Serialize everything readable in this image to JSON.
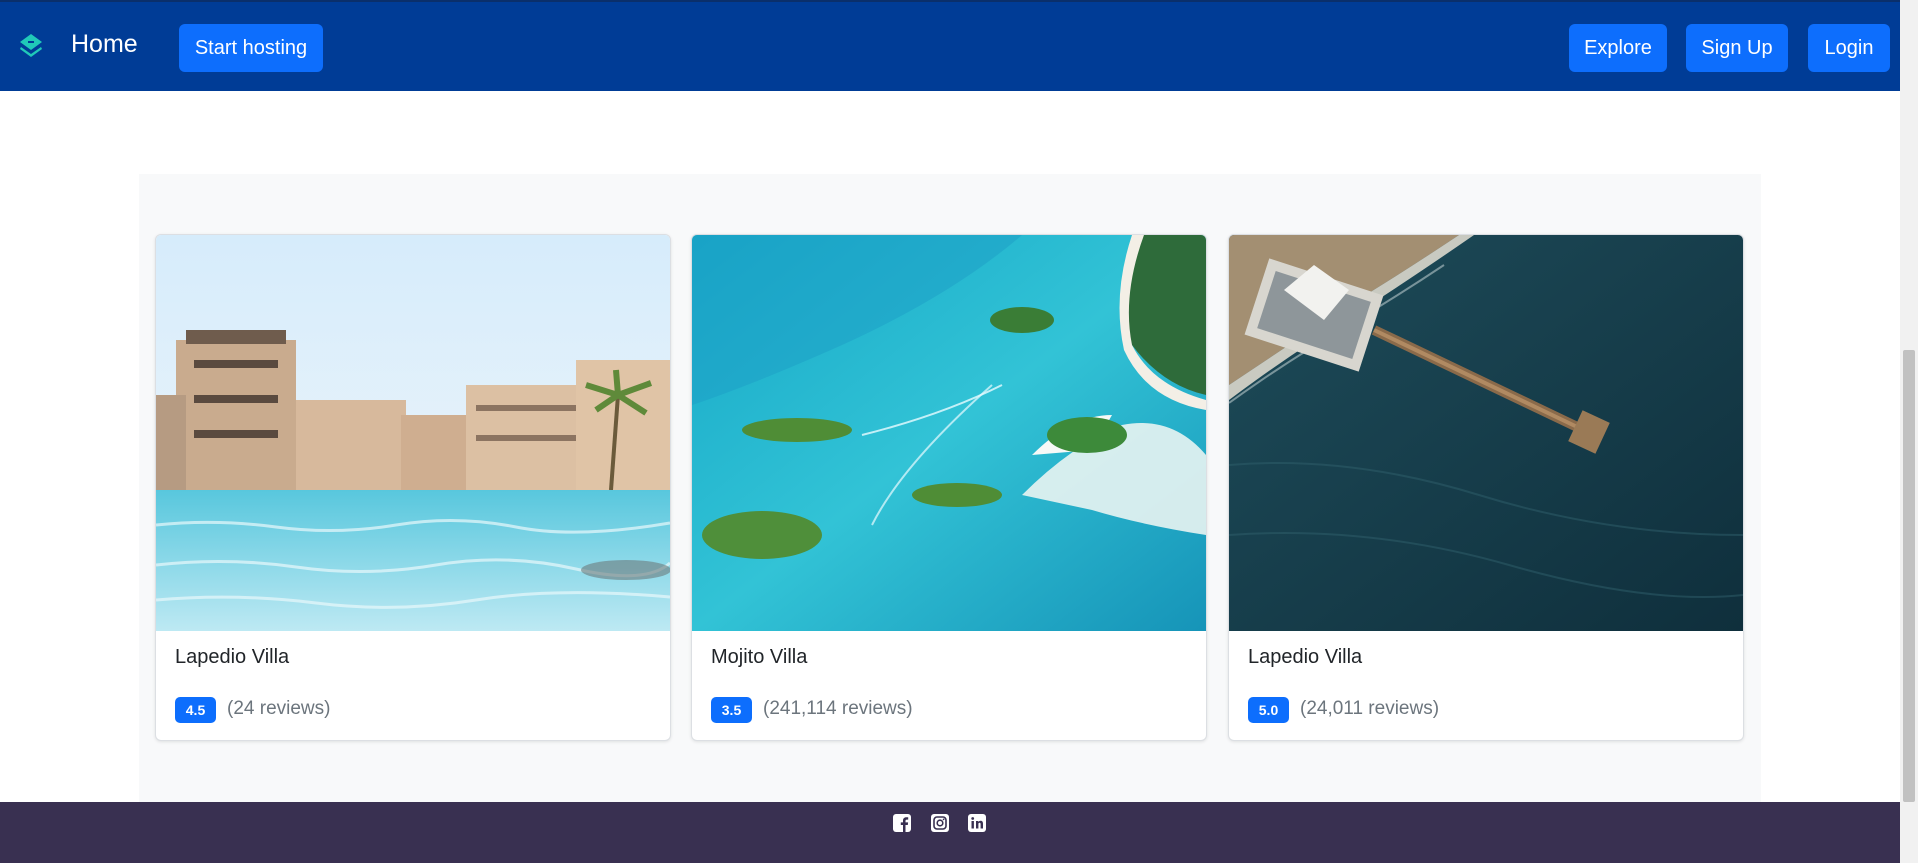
{
  "navbar": {
    "logo_icon": "layers-diamond-icon",
    "title": "Home",
    "host_button": "Start hosting",
    "links": [
      "Explore",
      "Sign Up",
      "Login"
    ]
  },
  "colors": {
    "navbar_bg": "#003c96",
    "button_primary": "#0d6efd",
    "logo_accent": "#20c9b8",
    "section_bg": "#f8f9fa",
    "footer_bg": "#393051"
  },
  "listings": [
    {
      "image": "luxury-resort-pool-photo",
      "name": "Lapedio Villa",
      "rating": "4.5",
      "reviews": "(24 reviews)"
    },
    {
      "image": "tropical-lagoon-aerial-photo",
      "name": "Mojito Villa",
      "rating": "3.5",
      "reviews": "(241,114 reviews)"
    },
    {
      "image": "ocean-pier-aerial-photo",
      "name": "Lapedio Villa",
      "rating": "5.0",
      "reviews": "(24,011 reviews)"
    }
  ],
  "footer": {
    "social_icons": [
      "facebook-icon",
      "instagram-icon",
      "linkedin-icon"
    ]
  }
}
